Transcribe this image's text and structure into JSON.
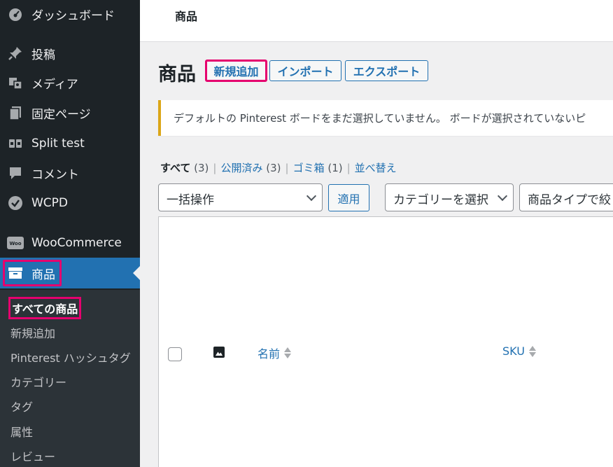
{
  "sidebar": {
    "items": [
      {
        "label": "ダッシュボード",
        "icon": "dashboard-icon"
      },
      {
        "label": "投稿",
        "icon": "pin-icon"
      },
      {
        "label": "メディア",
        "icon": "media-icon"
      },
      {
        "label": "固定ページ",
        "icon": "pages-icon"
      },
      {
        "label": "Split test",
        "icon": "split-test-icon"
      },
      {
        "label": "コメント",
        "icon": "comment-icon"
      },
      {
        "label": "WCPD",
        "icon": "check-circle-icon"
      },
      {
        "label": "WooCommerce",
        "icon": "woocommerce-icon"
      },
      {
        "label": "商品",
        "icon": "archive-icon"
      }
    ],
    "submenu": [
      "すべての商品",
      "新規追加",
      "Pinterest ハッシュタグ",
      "カテゴリー",
      "タグ",
      "属性",
      "レビュー"
    ]
  },
  "topbar": {
    "title": "商品"
  },
  "header": {
    "title": "商品",
    "add_new": "新規追加",
    "import": "インポート",
    "export": "エクスポート"
  },
  "notice": {
    "text": "デフォルトの Pinterest ボードをまだ選択していません。 ボードが選択されていないピ"
  },
  "views": {
    "all": "すべて",
    "all_count": "(3)",
    "published": "公開済み",
    "published_count": "(3)",
    "trash": "ゴミ箱",
    "trash_count": "(1)",
    "sort": "並べ替え",
    "sep": "|"
  },
  "filters": {
    "bulk": "一括操作",
    "apply": "適用",
    "category": "カテゴリーを選択",
    "type": "商品タイプで絞"
  },
  "table": {
    "columns": {
      "name": "名前",
      "sku": "SKU"
    }
  },
  "colors": {
    "accent": "#2271b1",
    "highlight": "#e5006e",
    "sidebar": "#1d2327"
  }
}
